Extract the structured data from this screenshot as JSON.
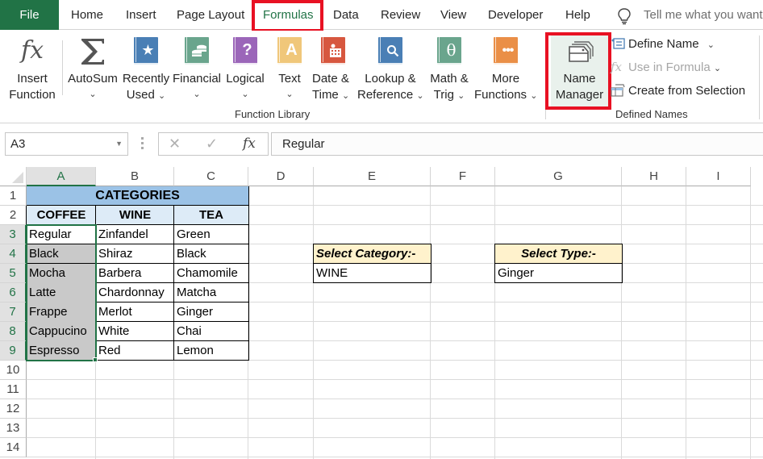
{
  "tabs": {
    "file": "File",
    "items": [
      "Home",
      "Insert",
      "Page Layout",
      "Formulas",
      "Data",
      "Review",
      "View",
      "Developer",
      "Help"
    ],
    "active": "Formulas",
    "tell_me_placeholder": "Tell me what you want"
  },
  "ribbon": {
    "function_library": {
      "label": "Function Library",
      "insert_function": [
        "Insert",
        "Function"
      ],
      "autosum": "AutoSum",
      "recently_used": [
        "Recently",
        "Used"
      ],
      "financial": "Financial",
      "logical": "Logical",
      "text": "Text",
      "date_time": [
        "Date &",
        "Time"
      ],
      "lookup_reference": [
        "Lookup &",
        "Reference"
      ],
      "math_trig": [
        "Math &",
        "Trig"
      ],
      "more_functions": [
        "More",
        "Functions"
      ]
    },
    "defined_names": {
      "label": "Defined Names",
      "name_manager": [
        "Name",
        "Manager"
      ],
      "define_name": "Define Name",
      "use_in_formula": "Use in Formula",
      "create_from_selection": "Create from Selection"
    },
    "icon_colors": {
      "recently_used": "#4a7fb5",
      "financial": "#6aa58d",
      "logical": "#9b66b9",
      "text": "#f0c77a",
      "date_time": "#d7573f",
      "lookup_reference": "#4a7fb5",
      "math_trig": "#6aa58d",
      "more_functions": "#ea8f47"
    },
    "highlight_color": "#e81123"
  },
  "formula_bar": {
    "name_box": "A3",
    "cancel_icon": "✕",
    "enter_icon": "✓",
    "fx_label": "fx",
    "value": "Regular"
  },
  "sheet": {
    "columns": [
      "A",
      "B",
      "C",
      "D",
      "E",
      "F",
      "G",
      "H",
      "I"
    ],
    "rows": [
      "1",
      "2",
      "3",
      "4",
      "5",
      "6",
      "7",
      "8",
      "9",
      "10",
      "11",
      "12",
      "13",
      "14"
    ],
    "selected_column": "A",
    "selected_rows": [
      "3",
      "4",
      "5",
      "6",
      "7",
      "8",
      "9"
    ],
    "title": "CATEGORIES",
    "headers": [
      "COFFEE",
      "WINE",
      "TEA"
    ],
    "table": [
      [
        "Regular",
        "Zinfandel",
        "Green"
      ],
      [
        "Black",
        "Shiraz",
        "Black"
      ],
      [
        "Mocha",
        "Barbera",
        "Chamomile"
      ],
      [
        "Latte",
        "Chardonnay",
        "Matcha"
      ],
      [
        "Frappe",
        "Merlot",
        "Ginger"
      ],
      [
        "Cappucino",
        "White",
        "Chai"
      ],
      [
        "Espresso",
        "Red",
        "Lemon"
      ]
    ],
    "select_category_label": "Select Category:-",
    "select_category_value": "WINE",
    "select_type_label": "Select Type:-",
    "select_type_value": "Ginger",
    "colors": {
      "title_fill": "#9bc2e6",
      "header_fill": "#ddebf7",
      "selection_fill": "#c9c9c9",
      "label_fill": "#fff2cc",
      "accent": "#217346"
    }
  }
}
